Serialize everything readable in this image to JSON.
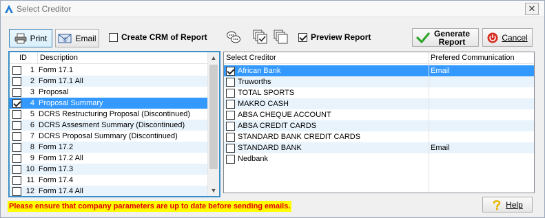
{
  "window": {
    "title": "Select Creditor",
    "close_glyph": "✕",
    "accent": "#1f7ad6"
  },
  "toolbar": {
    "print_label": "Print",
    "email_label": "Email",
    "create_crm_label": "Create CRM of Report",
    "create_crm_checked": false,
    "preview_label": "Preview Report",
    "preview_checked": true,
    "generate_label_line1": "Generate",
    "generate_label_line2": "Report",
    "cancel_label": "Cancel",
    "icons": [
      "printer-icon",
      "email-icon",
      "chat-bubbles-icon",
      "check-all-icon",
      "uncheck-all-icon",
      "green-check-icon",
      "power-icon"
    ]
  },
  "reports": {
    "columns": [
      "ID",
      "Description"
    ],
    "rows": [
      {
        "id": "1",
        "description": "Form 17.1",
        "checked": false
      },
      {
        "id": "2",
        "description": "Form 17.1 All",
        "checked": false
      },
      {
        "id": "3",
        "description": "Proposal",
        "checked": false
      },
      {
        "id": "4",
        "description": "Proposal Summary",
        "checked": true,
        "selected": true
      },
      {
        "id": "5",
        "description": "DCRS Restructuring Proposal (Discontinued)",
        "checked": false
      },
      {
        "id": "6",
        "description": "DCRS Assesment Summary (Discontinued)",
        "checked": false
      },
      {
        "id": "7",
        "description": "DCRS Proposal Summary (Discontinued)",
        "checked": false
      },
      {
        "id": "8",
        "description": "Form 17.2",
        "checked": false
      },
      {
        "id": "9",
        "description": "Form 17.2 All",
        "checked": false
      },
      {
        "id": "10",
        "description": "Form 17.3",
        "checked": false
      },
      {
        "id": "11",
        "description": "Form 17.4",
        "checked": false
      },
      {
        "id": "12",
        "description": "Form 17.4 All",
        "checked": false
      }
    ],
    "scroll_up": "▲",
    "scroll_down": "▼"
  },
  "creditors": {
    "columns": [
      "Select Creditor",
      "Prefered Communication"
    ],
    "rows": [
      {
        "name": "African Bank",
        "communication": "Email",
        "checked": true,
        "selected": true
      },
      {
        "name": "Truworths",
        "communication": "",
        "checked": false
      },
      {
        "name": "TOTAL SPORTS",
        "communication": "",
        "checked": false
      },
      {
        "name": "MAKRO CASH",
        "communication": "",
        "checked": false
      },
      {
        "name": "ABSA CHEQUE ACCOUNT",
        "communication": "",
        "checked": false
      },
      {
        "name": "ABSA CREDIT CARDS",
        "communication": "",
        "checked": false
      },
      {
        "name": "STANDARD BANK CREDIT CARDS",
        "communication": "",
        "checked": false
      },
      {
        "name": "STANDARD BANK",
        "communication": "Email",
        "checked": false
      },
      {
        "name": "Nedbank",
        "communication": "",
        "checked": false
      }
    ]
  },
  "footer": {
    "warning": "Please ensure that company parameters are up to date before sending emails.",
    "help_label": "Help",
    "help_icon": "question-icon"
  }
}
